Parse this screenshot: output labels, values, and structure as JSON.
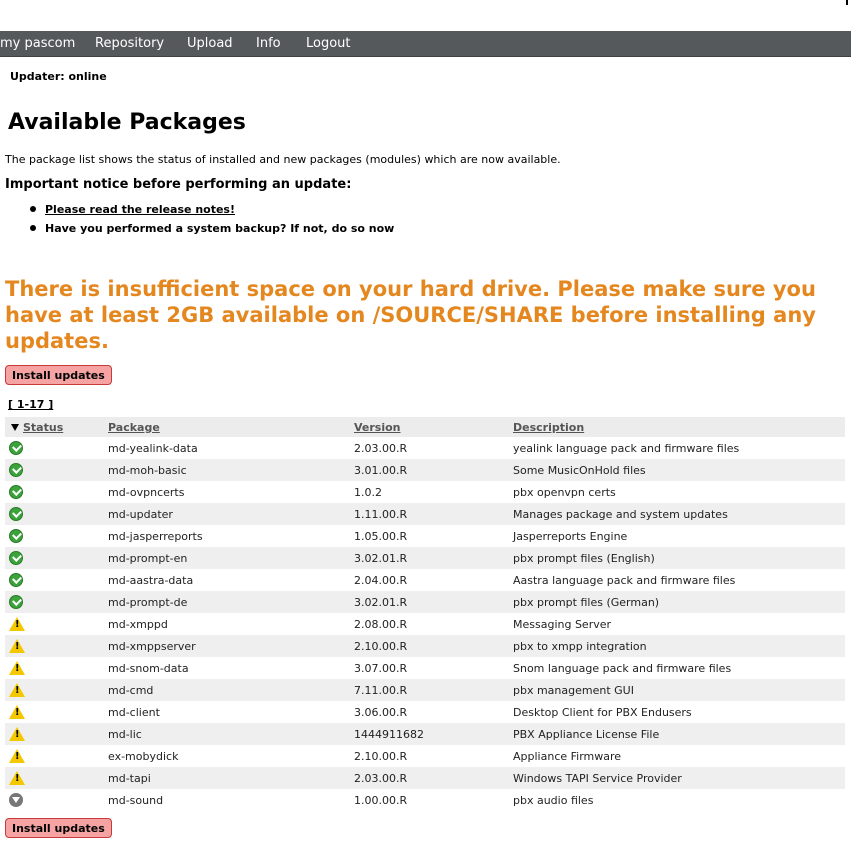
{
  "nav": {
    "items": [
      {
        "label": "my pascom"
      },
      {
        "label": "Repository"
      },
      {
        "label": "Upload"
      },
      {
        "label": "Info"
      },
      {
        "label": "Logout"
      }
    ]
  },
  "status_line": "Updater: online",
  "page_title": "Available Packages",
  "intro": "The package list shows the status of installed and new packages (modules) which are now available.",
  "notice": {
    "title": "Important notice before performing an update:",
    "items": [
      "Please read the release notes!",
      "Have you performed a system backup? If not, do so now"
    ]
  },
  "warning": "There is insufficient space on your hard drive. Please make sure you have at least 2GB available on /SOURCE/SHARE before installing any updates.",
  "buttons": {
    "install_top": "Install updates",
    "install_bottom": "Install updates"
  },
  "pager": "[ 1-17 ]",
  "colors": {
    "nav_bg": "#56595c",
    "warning": "#e4871f",
    "button_bg": "#f5a3a3",
    "button_border": "#c83a3a"
  },
  "table": {
    "headers": {
      "status": "Status",
      "package": "Package",
      "version": "Version",
      "description": "Description"
    },
    "rows": [
      {
        "status": "installed-icon",
        "package": "md-yealink-data",
        "version": "2.03.00.R",
        "description": "yealink language pack and firmware files"
      },
      {
        "status": "installed-icon",
        "package": "md-moh-basic",
        "version": "3.01.00.R",
        "description": "Some MusicOnHold files"
      },
      {
        "status": "installed-icon",
        "package": "md-ovpncerts",
        "version": "1.0.2",
        "description": "pbx openvpn certs"
      },
      {
        "status": "installed-icon",
        "package": "md-updater",
        "version": "1.11.00.R",
        "description": "Manages package and system updates"
      },
      {
        "status": "installed-icon",
        "package": "md-jasperreports",
        "version": "1.05.00.R",
        "description": "Jasperreports Engine"
      },
      {
        "status": "installed-icon",
        "package": "md-prompt-en",
        "version": "3.02.01.R",
        "description": "pbx prompt files (English)"
      },
      {
        "status": "installed-icon",
        "package": "md-aastra-data",
        "version": "2.04.00.R",
        "description": "Aastra language pack and firmware files"
      },
      {
        "status": "installed-icon",
        "package": "md-prompt-de",
        "version": "3.02.01.R",
        "description": "pbx prompt files (German)"
      },
      {
        "status": "update-warning-icon",
        "package": "md-xmppd",
        "version": "2.08.00.R",
        "description": "Messaging Server"
      },
      {
        "status": "update-warning-icon",
        "package": "md-xmppserver",
        "version": "2.10.00.R",
        "description": "pbx to xmpp integration"
      },
      {
        "status": "update-warning-icon",
        "package": "md-snom-data",
        "version": "3.07.00.R",
        "description": "Snom language pack and firmware files"
      },
      {
        "status": "update-warning-icon",
        "package": "md-cmd",
        "version": "7.11.00.R",
        "description": "pbx management GUI"
      },
      {
        "status": "update-warning-icon",
        "package": "md-client",
        "version": "3.06.00.R",
        "description": "Desktop Client for PBX Endusers"
      },
      {
        "status": "update-warning-icon",
        "package": "md-lic",
        "version": "1444911682",
        "description": "PBX Appliance License File"
      },
      {
        "status": "update-warning-icon",
        "package": "ex-mobydick",
        "version": "2.10.00.R",
        "description": "Appliance Firmware"
      },
      {
        "status": "update-warning-icon",
        "package": "md-tapi",
        "version": "2.03.00.R",
        "description": "Windows TAPI Service Provider"
      },
      {
        "status": "download-icon",
        "package": "md-sound",
        "version": "1.00.00.R",
        "description": "pbx audio files"
      }
    ]
  }
}
